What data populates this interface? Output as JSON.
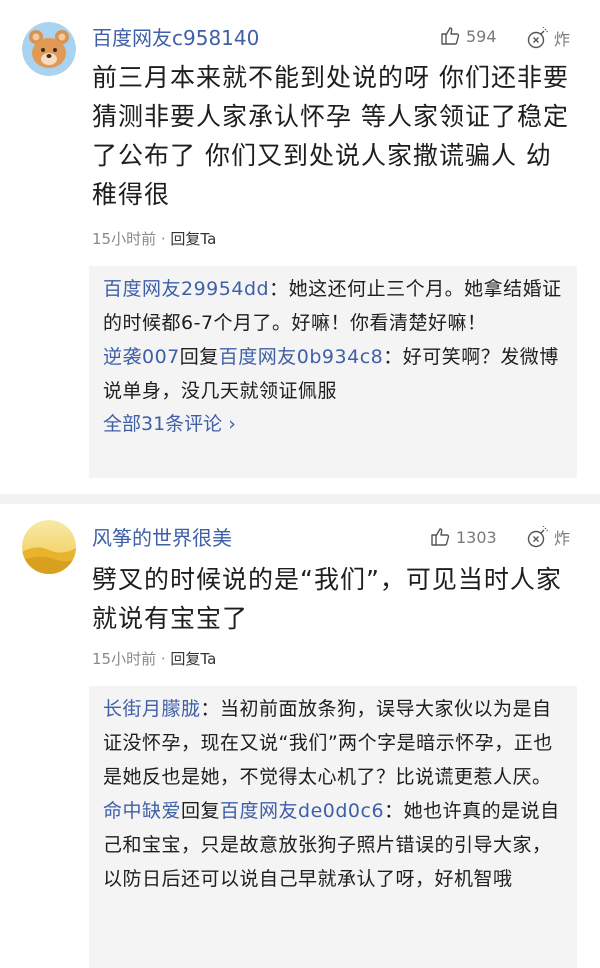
{
  "comments": [
    {
      "username": "百度网友c958140",
      "likes": "594",
      "bomb_label": "炸",
      "text": "前三月本来就不能到处说的呀 你们还非要猜测非要人家承认怀孕  等人家领证了稳定了公布了 你们又到处说人家撒谎骗人 幼稚得很",
      "time": "15小时前",
      "reply_label": "回复Ta",
      "replies": [
        {
          "name": "百度网友29954dd",
          "sep": "：",
          "text": "她这还何止三个月。她拿结婚证的时候都6-7个月了。好嘛！你看清楚好嘛！"
        },
        {
          "name": "逆袭007",
          "mid": "回复",
          "target": "百度网友0b934c8",
          "sep": "：",
          "text": "好可笑啊？发微博说单身，没几天就领证佩服"
        }
      ],
      "view_all": "全部31条评论 ›"
    },
    {
      "username": "风筝的世界很美",
      "likes": "1303",
      "bomb_label": "炸",
      "text": "劈叉的时候说的是“我们”，可见当时人家就说有宝宝了",
      "time": "15小时前",
      "reply_label": "回复Ta",
      "replies": [
        {
          "name": "长街月朦胧",
          "sep": "：",
          "text": "当初前面放条狗，误导大家伙以为是自证没怀孕，现在又说“我们”两个字是暗示怀孕，正也是她反也是她，不觉得太心机了？比说谎更惹人厌。"
        },
        {
          "name": "命中缺爱",
          "mid": "回复",
          "target": "百度网友de0d0c6",
          "sep": "：",
          "text": "她也许真的是说自己和宝宝，只是故意放张狗子照片错误的引导大家，以防日后还可以说自己早就承认了呀，好机智哦"
        }
      ]
    }
  ],
  "icons": {
    "like": "thumbs-up-icon",
    "bomb": "bomb-icon",
    "avatar1": "bear-avatar",
    "avatar2": "desert-avatar"
  },
  "colors": {
    "username": "#3f5fa8",
    "reply_bg": "#f4f4f4",
    "meta": "#8a8a8a"
  }
}
